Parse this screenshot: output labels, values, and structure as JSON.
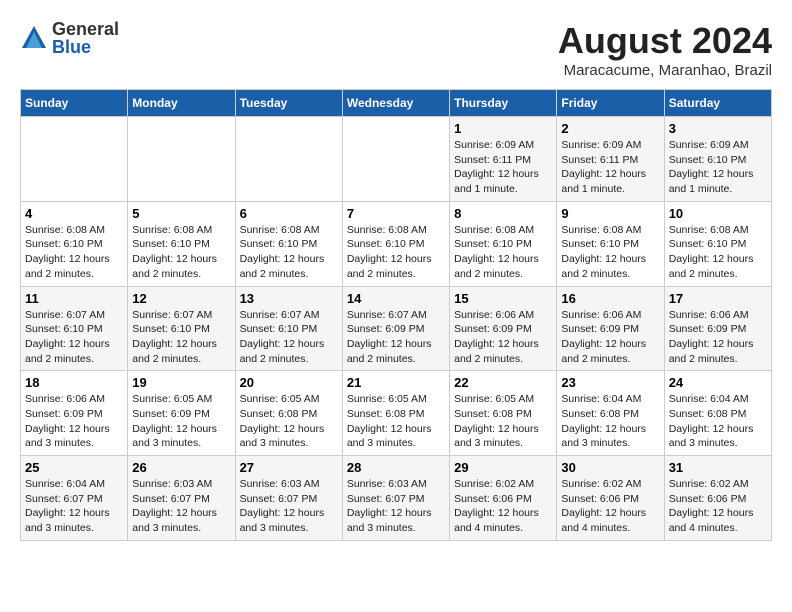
{
  "header": {
    "logo_general": "General",
    "logo_blue": "Blue",
    "month_year": "August 2024",
    "location": "Maracacume, Maranhao, Brazil"
  },
  "weekdays": [
    "Sunday",
    "Monday",
    "Tuesday",
    "Wednesday",
    "Thursday",
    "Friday",
    "Saturday"
  ],
  "weeks": [
    [
      {
        "day": "",
        "info": ""
      },
      {
        "day": "",
        "info": ""
      },
      {
        "day": "",
        "info": ""
      },
      {
        "day": "",
        "info": ""
      },
      {
        "day": "1",
        "info": "Sunrise: 6:09 AM\nSunset: 6:11 PM\nDaylight: 12 hours\nand 1 minute."
      },
      {
        "day": "2",
        "info": "Sunrise: 6:09 AM\nSunset: 6:11 PM\nDaylight: 12 hours\nand 1 minute."
      },
      {
        "day": "3",
        "info": "Sunrise: 6:09 AM\nSunset: 6:10 PM\nDaylight: 12 hours\nand 1 minute."
      }
    ],
    [
      {
        "day": "4",
        "info": "Sunrise: 6:08 AM\nSunset: 6:10 PM\nDaylight: 12 hours\nand 2 minutes."
      },
      {
        "day": "5",
        "info": "Sunrise: 6:08 AM\nSunset: 6:10 PM\nDaylight: 12 hours\nand 2 minutes."
      },
      {
        "day": "6",
        "info": "Sunrise: 6:08 AM\nSunset: 6:10 PM\nDaylight: 12 hours\nand 2 minutes."
      },
      {
        "day": "7",
        "info": "Sunrise: 6:08 AM\nSunset: 6:10 PM\nDaylight: 12 hours\nand 2 minutes."
      },
      {
        "day": "8",
        "info": "Sunrise: 6:08 AM\nSunset: 6:10 PM\nDaylight: 12 hours\nand 2 minutes."
      },
      {
        "day": "9",
        "info": "Sunrise: 6:08 AM\nSunset: 6:10 PM\nDaylight: 12 hours\nand 2 minutes."
      },
      {
        "day": "10",
        "info": "Sunrise: 6:08 AM\nSunset: 6:10 PM\nDaylight: 12 hours\nand 2 minutes."
      }
    ],
    [
      {
        "day": "11",
        "info": "Sunrise: 6:07 AM\nSunset: 6:10 PM\nDaylight: 12 hours\nand 2 minutes."
      },
      {
        "day": "12",
        "info": "Sunrise: 6:07 AM\nSunset: 6:10 PM\nDaylight: 12 hours\nand 2 minutes."
      },
      {
        "day": "13",
        "info": "Sunrise: 6:07 AM\nSunset: 6:10 PM\nDaylight: 12 hours\nand 2 minutes."
      },
      {
        "day": "14",
        "info": "Sunrise: 6:07 AM\nSunset: 6:09 PM\nDaylight: 12 hours\nand 2 minutes."
      },
      {
        "day": "15",
        "info": "Sunrise: 6:06 AM\nSunset: 6:09 PM\nDaylight: 12 hours\nand 2 minutes."
      },
      {
        "day": "16",
        "info": "Sunrise: 6:06 AM\nSunset: 6:09 PM\nDaylight: 12 hours\nand 2 minutes."
      },
      {
        "day": "17",
        "info": "Sunrise: 6:06 AM\nSunset: 6:09 PM\nDaylight: 12 hours\nand 2 minutes."
      }
    ],
    [
      {
        "day": "18",
        "info": "Sunrise: 6:06 AM\nSunset: 6:09 PM\nDaylight: 12 hours\nand 3 minutes."
      },
      {
        "day": "19",
        "info": "Sunrise: 6:05 AM\nSunset: 6:09 PM\nDaylight: 12 hours\nand 3 minutes."
      },
      {
        "day": "20",
        "info": "Sunrise: 6:05 AM\nSunset: 6:08 PM\nDaylight: 12 hours\nand 3 minutes."
      },
      {
        "day": "21",
        "info": "Sunrise: 6:05 AM\nSunset: 6:08 PM\nDaylight: 12 hours\nand 3 minutes."
      },
      {
        "day": "22",
        "info": "Sunrise: 6:05 AM\nSunset: 6:08 PM\nDaylight: 12 hours\nand 3 minutes."
      },
      {
        "day": "23",
        "info": "Sunrise: 6:04 AM\nSunset: 6:08 PM\nDaylight: 12 hours\nand 3 minutes."
      },
      {
        "day": "24",
        "info": "Sunrise: 6:04 AM\nSunset: 6:08 PM\nDaylight: 12 hours\nand 3 minutes."
      }
    ],
    [
      {
        "day": "25",
        "info": "Sunrise: 6:04 AM\nSunset: 6:07 PM\nDaylight: 12 hours\nand 3 minutes."
      },
      {
        "day": "26",
        "info": "Sunrise: 6:03 AM\nSunset: 6:07 PM\nDaylight: 12 hours\nand 3 minutes."
      },
      {
        "day": "27",
        "info": "Sunrise: 6:03 AM\nSunset: 6:07 PM\nDaylight: 12 hours\nand 3 minutes."
      },
      {
        "day": "28",
        "info": "Sunrise: 6:03 AM\nSunset: 6:07 PM\nDaylight: 12 hours\nand 3 minutes."
      },
      {
        "day": "29",
        "info": "Sunrise: 6:02 AM\nSunset: 6:06 PM\nDaylight: 12 hours\nand 4 minutes."
      },
      {
        "day": "30",
        "info": "Sunrise: 6:02 AM\nSunset: 6:06 PM\nDaylight: 12 hours\nand 4 minutes."
      },
      {
        "day": "31",
        "info": "Sunrise: 6:02 AM\nSunset: 6:06 PM\nDaylight: 12 hours\nand 4 minutes."
      }
    ]
  ]
}
